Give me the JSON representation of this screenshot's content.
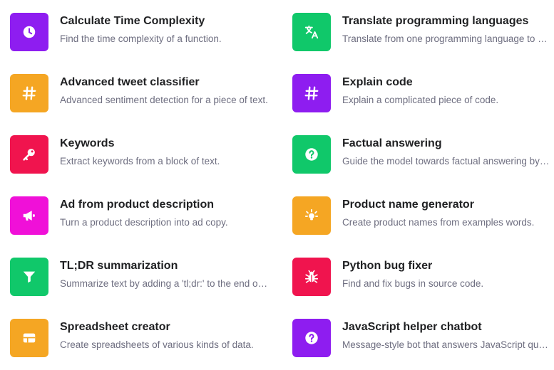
{
  "examples": [
    {
      "title": "Calculate Time Complexity",
      "description": "Find the time complexity of a function.",
      "icon": "clock-icon",
      "color": "#8e1df0"
    },
    {
      "title": "Translate programming languages",
      "description": "Translate from one programming language to another.",
      "icon": "translate-icon",
      "color": "#10c86a"
    },
    {
      "title": "Advanced tweet classifier",
      "description": "Advanced sentiment detection for a piece of text.",
      "icon": "hashtag-icon",
      "color": "#f5a623"
    },
    {
      "title": "Explain code",
      "description": "Explain a complicated piece of code.",
      "icon": "hashtag-icon",
      "color": "#8e1df0"
    },
    {
      "title": "Keywords",
      "description": "Extract keywords from a block of text.",
      "icon": "key-icon",
      "color": "#f0144e"
    },
    {
      "title": "Factual answering",
      "description": "Guide the model towards factual answering by showing it how to respond.",
      "icon": "question-icon",
      "color": "#10c86a"
    },
    {
      "title": "Ad from product description",
      "description": "Turn a product description into ad copy.",
      "icon": "megaphone-icon",
      "color": "#f010d8"
    },
    {
      "title": "Product name generator",
      "description": "Create product names from examples words.",
      "icon": "lightbulb-icon",
      "color": "#f5a623"
    },
    {
      "title": "TL;DR summarization",
      "description": "Summarize text by adding a 'tl;dr:' to the end of a text passage.",
      "icon": "funnel-icon",
      "color": "#10c86a"
    },
    {
      "title": "Python bug fixer",
      "description": "Find and fix bugs in source code.",
      "icon": "bug-icon",
      "color": "#f0144e"
    },
    {
      "title": "Spreadsheet creator",
      "description": "Create spreadsheets of various kinds of data.",
      "icon": "table-icon",
      "color": "#f5a623"
    },
    {
      "title": "JavaScript helper chatbot",
      "description": "Message-style bot that answers JavaScript questions.",
      "icon": "question-icon",
      "color": "#8e1df0"
    }
  ]
}
